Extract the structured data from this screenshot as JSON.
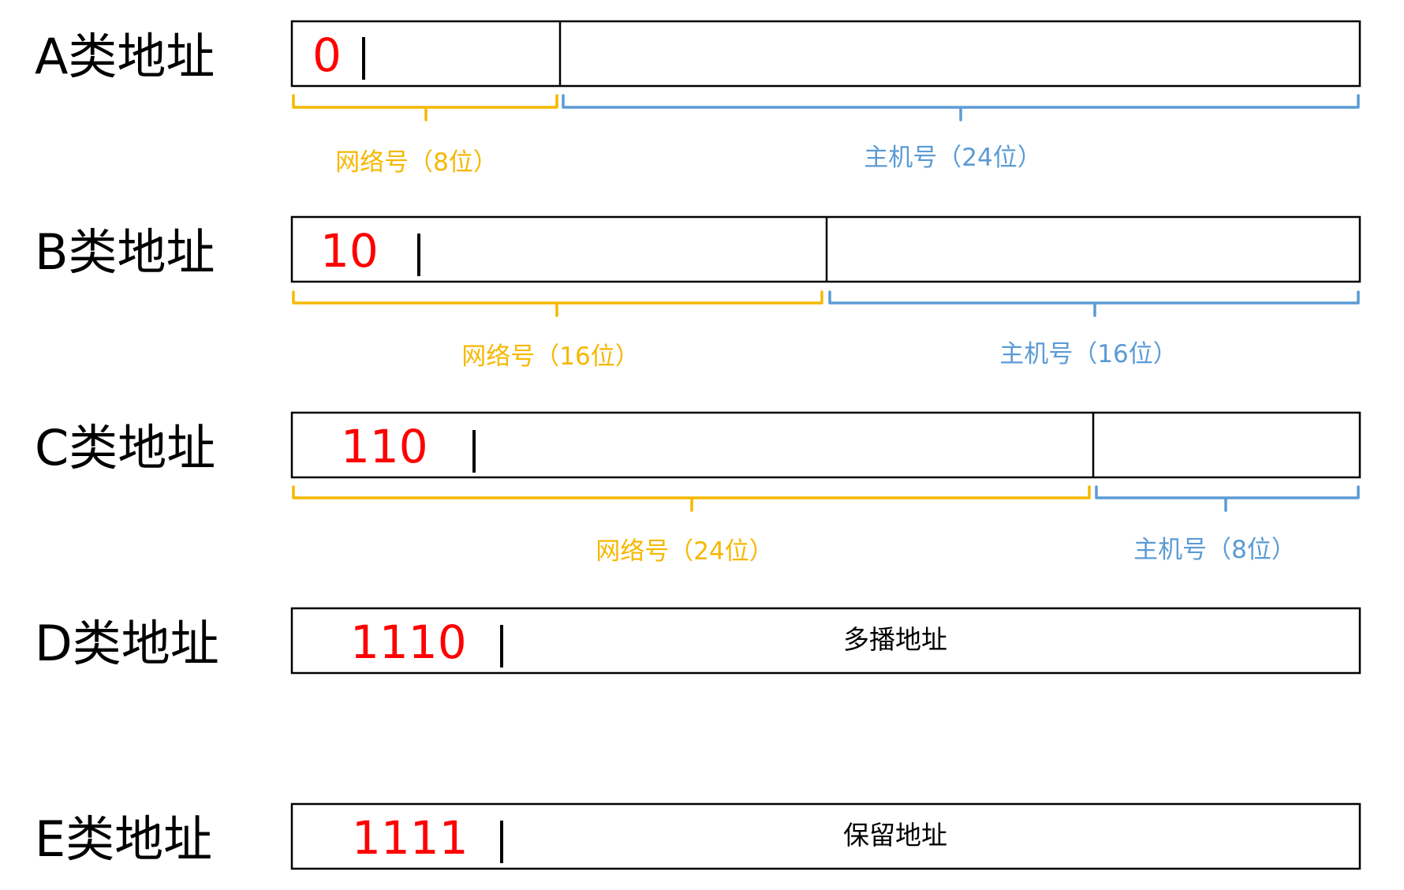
{
  "colors": {
    "network": "#f5b800",
    "host": "#5b9bd5",
    "prefix": "#ff0000",
    "border": "#000000"
  },
  "rows": [
    {
      "class_label": "A类地址",
      "prefix_bits": "0",
      "network": {
        "label": "网络号（8位）",
        "bits": 8
      },
      "host": {
        "label": "主机号（24位）",
        "bits": 24
      },
      "inner_text": ""
    },
    {
      "class_label": "B类地址",
      "prefix_bits": "10",
      "network": {
        "label": "网络号（16位）",
        "bits": 16
      },
      "host": {
        "label": "主机号（16位）",
        "bits": 16
      },
      "inner_text": ""
    },
    {
      "class_label": "C类地址",
      "prefix_bits": "110",
      "network": {
        "label": "网络号（24位）",
        "bits": 24
      },
      "host": {
        "label": "主机号（8位）",
        "bits": 8
      },
      "inner_text": ""
    },
    {
      "class_label": "D类地址",
      "prefix_bits": "1110",
      "network": null,
      "host": null,
      "inner_text": "多播地址"
    },
    {
      "class_label": "E类地址",
      "prefix_bits": "1111",
      "network": null,
      "host": null,
      "inner_text": "保留地址"
    }
  ]
}
